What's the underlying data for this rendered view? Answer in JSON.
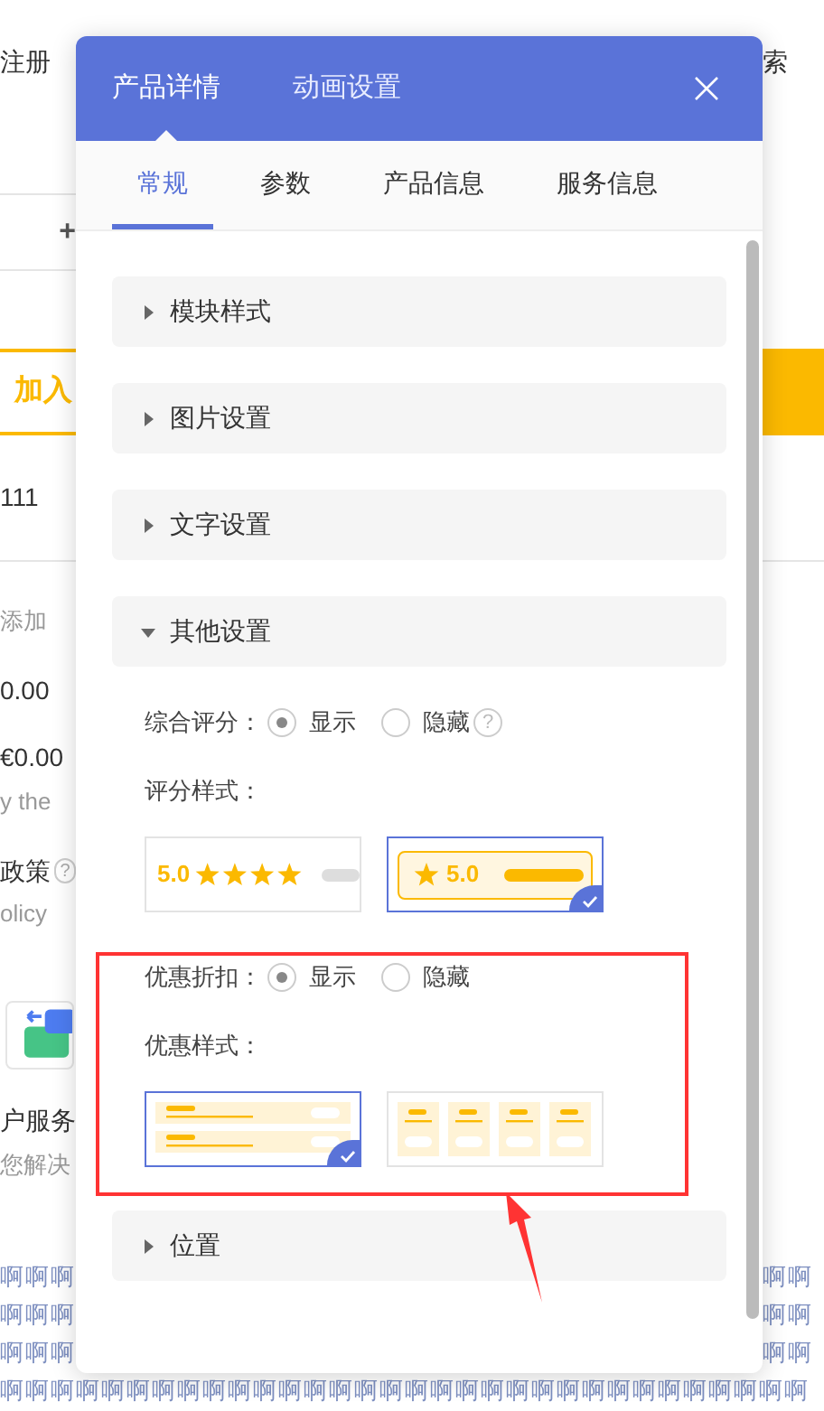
{
  "background": {
    "left": [
      {
        "kind": "text",
        "text": "注册"
      },
      {
        "kind": "rule"
      },
      {
        "kind": "plus",
        "text": "+"
      },
      {
        "kind": "add_button",
        "text": "加入"
      },
      {
        "kind": "text",
        "text": "111"
      },
      {
        "kind": "muted",
        "text": "添加"
      },
      {
        "kind": "text",
        "text": "0.00"
      },
      {
        "kind": "text",
        "text": "€0.00"
      },
      {
        "kind": "muted",
        "text": "y the"
      },
      {
        "kind": "help_text",
        "text": "政策",
        "help": "?"
      },
      {
        "kind": "muted",
        "text": "olicy"
      },
      {
        "kind": "app_icon"
      },
      {
        "kind": "text",
        "text": "户服务"
      },
      {
        "kind": "muted",
        "text": "您解决"
      },
      {
        "kind": "pattern",
        "text": "啊啊啊"
      },
      {
        "kind": "pattern",
        "text": "啊啊啊"
      },
      {
        "kind": "pattern",
        "text": "啊啊啊"
      }
    ],
    "right": [
      {
        "kind": "text",
        "text": "索"
      },
      {
        "kind": "yellow_bar"
      },
      {
        "kind": "rule"
      },
      {
        "kind": "pattern",
        "text": "啊啊"
      },
      {
        "kind": "pattern",
        "text": "啊啊"
      },
      {
        "kind": "pattern",
        "text": "啊啊"
      }
    ],
    "bottom_pattern": "啊啊啊啊啊啊啊啊啊啊啊啊啊啊啊啊啊啊啊啊啊啊啊啊啊啊啊啊啊啊啊啊"
  },
  "dialog": {
    "tabs": [
      {
        "label": "产品详情",
        "selected": true
      },
      {
        "label": "动画设置",
        "selected": false
      }
    ],
    "subtabs": [
      {
        "label": "常规",
        "selected": true
      },
      {
        "label": "参数",
        "selected": false
      },
      {
        "label": "产品信息",
        "selected": false
      },
      {
        "label": "服务信息",
        "selected": false
      }
    ],
    "sections": [
      {
        "title": "模块样式",
        "expanded": false
      },
      {
        "title": "图片设置",
        "expanded": false
      },
      {
        "title": "文字设置",
        "expanded": false
      },
      {
        "title": "其他设置",
        "expanded": true,
        "settings": [
          {
            "kind": "radio",
            "label": "综合评分：",
            "help": "?",
            "options": [
              {
                "label": "显示",
                "selected": true
              },
              {
                "label": "隐藏",
                "selected": false
              }
            ]
          },
          {
            "kind": "styles",
            "label": "评分样式：",
            "options": [
              {
                "kind": "stars",
                "score": "5.0",
                "selected": false
              },
              {
                "kind": "bar",
                "score": "5.0",
                "selected": true
              }
            ]
          }
        ],
        "highlighted_settings": [
          {
            "kind": "radio",
            "label": "优惠折扣：",
            "options": [
              {
                "label": "显示",
                "selected": true
              },
              {
                "label": "隐藏",
                "selected": false
              }
            ]
          },
          {
            "kind": "styles",
            "label": "优惠样式：",
            "options": [
              {
                "kind": "rows",
                "selected": true
              },
              {
                "kind": "grid",
                "selected": false
              }
            ]
          }
        ]
      },
      {
        "title": "位置",
        "expanded": false
      }
    ]
  }
}
